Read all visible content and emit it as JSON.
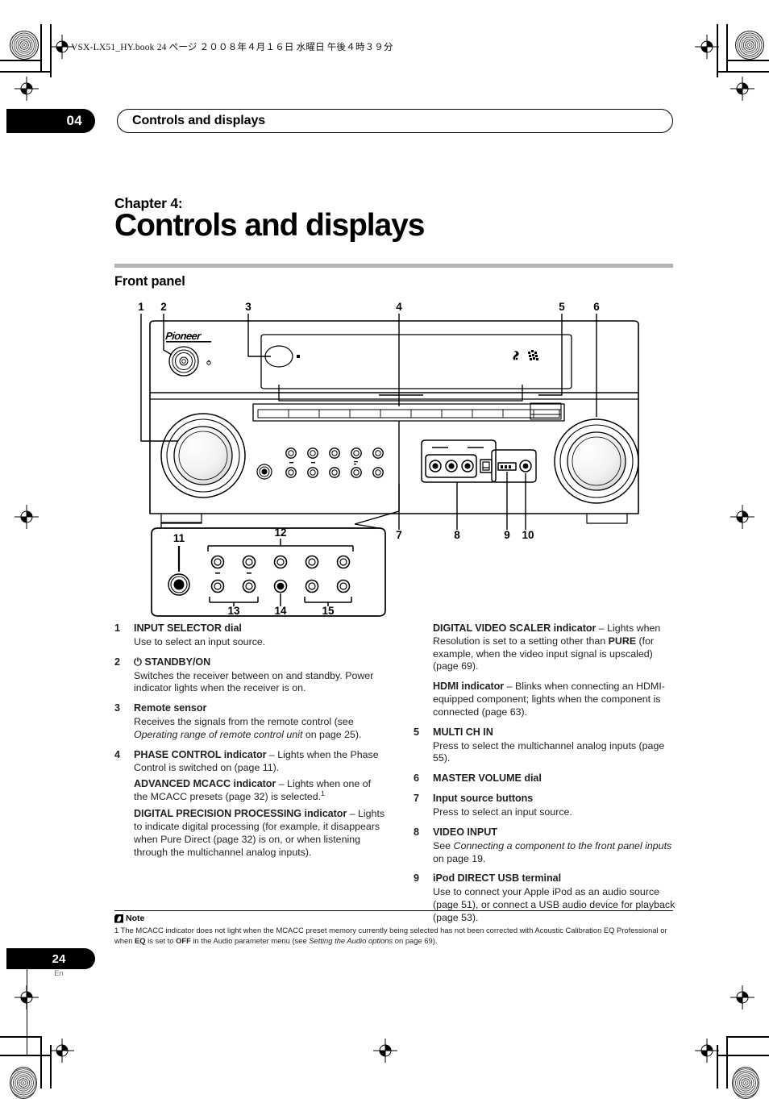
{
  "print_marks": {
    "book_line": "VSX-LX51_HY.book   24 ページ   ２００８年４月１６日   水曜日   午後４時３９分"
  },
  "header": {
    "chapter_number": "04",
    "running_title": "Controls and displays"
  },
  "title": {
    "chapter_label": "Chapter 4:",
    "chapter_title": "Controls and displays",
    "section": "Front panel"
  },
  "figure": {
    "brand": "Pioneer",
    "callouts": [
      "1",
      "2",
      "3",
      "4",
      "5",
      "6",
      "7",
      "8",
      "9",
      "10",
      "11",
      "12",
      "13",
      "14",
      "15"
    ]
  },
  "left_column": [
    {
      "num": "1",
      "head": "INPUT SELECTOR dial",
      "desc": "Use to select an input source."
    },
    {
      "num": "2",
      "head": "⏻ STANDBY/ON",
      "desc": "Switches the receiver between on and standby. Power indicator lights when the receiver is on."
    },
    {
      "num": "3",
      "head": "Remote sensor",
      "desc_pre": "Receives the signals from the remote control (see ",
      "desc_italic": "Operating range of remote control unit",
      "desc_post": " on page 25)."
    },
    {
      "num": "4",
      "head": "PHASE CONTROL indicator",
      "desc": " – Lights when the Phase Control is switched on (page 11).",
      "sub2_head": "ADVANCED MCACC indicator",
      "sub2_desc": " – Lights when one of the MCACC presets (page 32) is selected.",
      "sub2_footnote": "1",
      "sub3_head": "DIGITAL PRECISION PROCESSING indicator",
      "sub3_desc": " – Lights to indicate digital processing (for example, it disappears when Pure Direct (page 32) is on, or when listening through the multichannel analog inputs)."
    }
  ],
  "right_column": [
    {
      "num": "",
      "head": "DIGITAL VIDEO SCALER indicator",
      "desc_pre": " – Lights when Resolution is set to a setting other than ",
      "desc_bold": "PURE",
      "desc_post": " (for example, when the video input signal is upscaled) (page 69)."
    },
    {
      "num": "",
      "head": "HDMI indicator",
      "desc": " – Blinks when connecting an HDMI-equipped component; lights when the component is connected (page 63)."
    },
    {
      "num": "5",
      "head": "MULTI CH IN",
      "desc": "Press to select the multichannel analog inputs (page 55)."
    },
    {
      "num": "6",
      "head": "MASTER VOLUME dial",
      "desc": ""
    },
    {
      "num": "7",
      "head": "Input source buttons",
      "desc": "Press to select an input source."
    },
    {
      "num": "8",
      "head": "VIDEO INPUT",
      "desc_pre": "See ",
      "desc_italic": "Connecting a component to the front panel inputs",
      "desc_post": " on page 19."
    },
    {
      "num": "9",
      "head": "iPod DIRECT USB terminal",
      "desc": "Use to connect your Apple iPod as an audio source (page 51), or connect a USB audio device for playback (page 53)."
    }
  ],
  "note": {
    "label": "Note",
    "line1_pre": "1 The MCACC indicator does not light when the MCACC preset memory currently being selected has not been corrected with Acoustic Calibration EQ Professional or when ",
    "eq": "EQ",
    "line1_mid": " is set to ",
    "off": "OFF",
    "line1_post": " in the Audio parameter menu (see ",
    "italic_ref": "Setting the Audio options",
    "line1_end": " on page 69)."
  },
  "footer": {
    "page_number": "24",
    "language": "En"
  },
  "colors": {
    "accent_bar": "#b3b3b3",
    "text": "#231f20",
    "black": "#000000"
  }
}
